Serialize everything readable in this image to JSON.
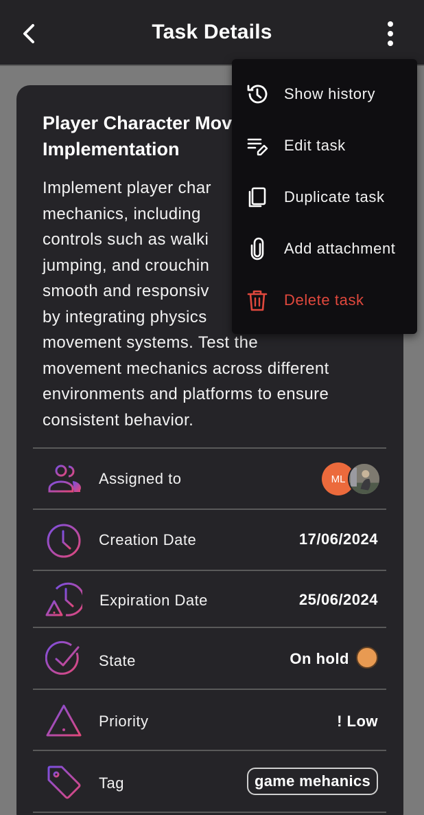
{
  "header": {
    "title": "Task Details"
  },
  "task": {
    "title_line1": "Player Character Mov",
    "title_line2": "Implementation",
    "description_lines": [
      "Implement player char",
      "mechanics, including",
      "controls such as walki",
      "jumping, and crouchin",
      "smooth and responsiv",
      "by integrating physics",
      "movement systems. Test the",
      "movement mechanics across different",
      "environments and platforms to ensure",
      "consistent behavior."
    ]
  },
  "details": {
    "assigned": {
      "label": "Assigned to",
      "avatar_initials": "ML",
      "avatar_color": "#ec6a3c"
    },
    "creation": {
      "label": "Creation Date",
      "value": "17/06/2024"
    },
    "expiration": {
      "label": "Expiration Date",
      "value": "25/06/2024"
    },
    "state": {
      "label": "State",
      "value": "On hold",
      "color": "#e89a52"
    },
    "priority": {
      "label": "Priority",
      "value": "! Low"
    },
    "tag": {
      "label": "Tag",
      "value": "game mehanics"
    }
  },
  "menu": {
    "items": [
      {
        "label": "Show history",
        "icon": "history-icon"
      },
      {
        "label": "Edit task",
        "icon": "edit-icon"
      },
      {
        "label": "Duplicate task",
        "icon": "copy-icon"
      },
      {
        "label": "Add attachment",
        "icon": "paperclip-icon"
      },
      {
        "label": "Delete task",
        "icon": "trash-icon",
        "color": "#e0483d"
      }
    ]
  },
  "colors": {
    "gradient_start": "#7b4fe0",
    "gradient_end": "#e0487a",
    "background": "#252428"
  }
}
